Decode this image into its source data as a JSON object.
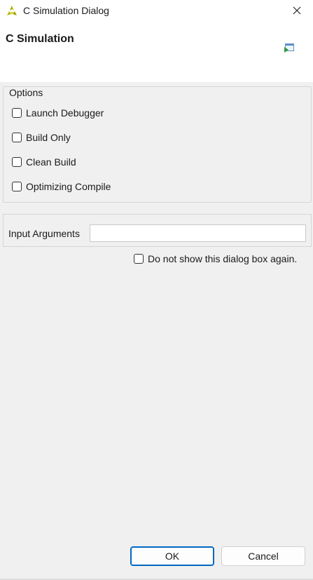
{
  "window": {
    "title": "C Simulation Dialog",
    "close_icon": "close-icon",
    "app_icon": "vivado-hls-logo-icon"
  },
  "header": {
    "title": "C Simulation",
    "icon": "run-simulation-icon"
  },
  "options": {
    "legend": "Options",
    "items": [
      {
        "label": "Launch Debugger",
        "checked": false
      },
      {
        "label": "Build Only",
        "checked": false
      },
      {
        "label": "Clean Build",
        "checked": false
      },
      {
        "label": "Optimizing Compile",
        "checked": false
      }
    ]
  },
  "input_arguments": {
    "label": "Input Arguments",
    "value": ""
  },
  "dont_show": {
    "label": "Do not show this dialog box again.",
    "checked": false
  },
  "buttons": {
    "ok": "OK",
    "cancel": "Cancel"
  },
  "colors": {
    "accent": "#0067c0",
    "background": "#f0f0f0",
    "header_background": "#ffffff"
  }
}
